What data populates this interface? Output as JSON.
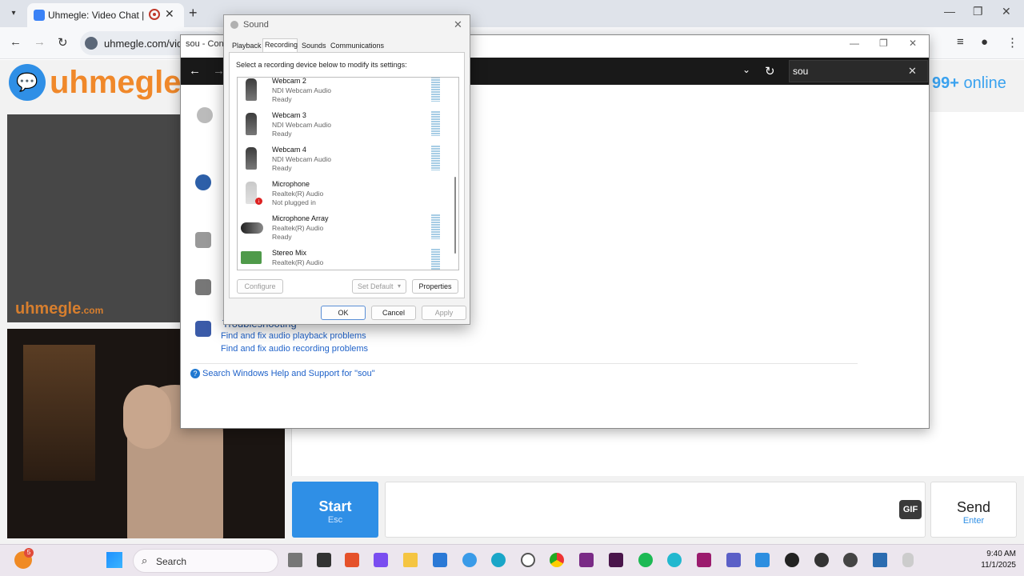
{
  "browser": {
    "tab_title": "Uhmegle: Video Chat | Rand",
    "address": "uhmegle.com/vide",
    "window_controls": [
      "—",
      "❐",
      "✕"
    ]
  },
  "uhmegle": {
    "logo": "uhmegle",
    "online_count": "99+",
    "online_label": "online",
    "watermark": "uhmegle",
    "watermark_suffix": ".com",
    "start_label": "Start",
    "start_key": "Esc",
    "gif_label": "GIF",
    "send_label": "Send",
    "send_key": "Enter"
  },
  "control_panel": {
    "title": "sou - Control Panel",
    "search_value": "sou",
    "troubleshooting_heading": "Troubleshooting",
    "links": [
      "Find and fix audio playback problems",
      "Find and fix audio recording problems"
    ],
    "help_text": "Search Windows Help and Support for \"sou\""
  },
  "sound_dialog": {
    "title": "Sound",
    "tabs": [
      "Playback",
      "Recording",
      "Sounds",
      "Communications"
    ],
    "active_tab": "Recording",
    "instruction": "Select a recording device below to modify its settings:",
    "devices": [
      {
        "name": "Webcam 2",
        "driver": "NDI Webcam Audio",
        "status": "Ready"
      },
      {
        "name": "Webcam 3",
        "driver": "NDI Webcam Audio",
        "status": "Ready"
      },
      {
        "name": "Webcam 4",
        "driver": "NDI Webcam Audio",
        "status": "Ready"
      },
      {
        "name": "Microphone",
        "driver": "Realtek(R) Audio",
        "status": "Not plugged in"
      },
      {
        "name": "Microphone Array",
        "driver": "Realtek(R) Audio",
        "status": "Ready"
      },
      {
        "name": "Stereo Mix",
        "driver": "Realtek(R) Audio",
        "status": ""
      }
    ],
    "buttons": {
      "configure": "Configure",
      "set_default": "Set Default",
      "properties": "Properties",
      "ok": "OK",
      "cancel": "Cancel",
      "apply": "Apply"
    }
  },
  "taskbar": {
    "search_label": "Search",
    "time": "9:40 AM",
    "date": "11/1/2025",
    "notification_count": "5"
  }
}
